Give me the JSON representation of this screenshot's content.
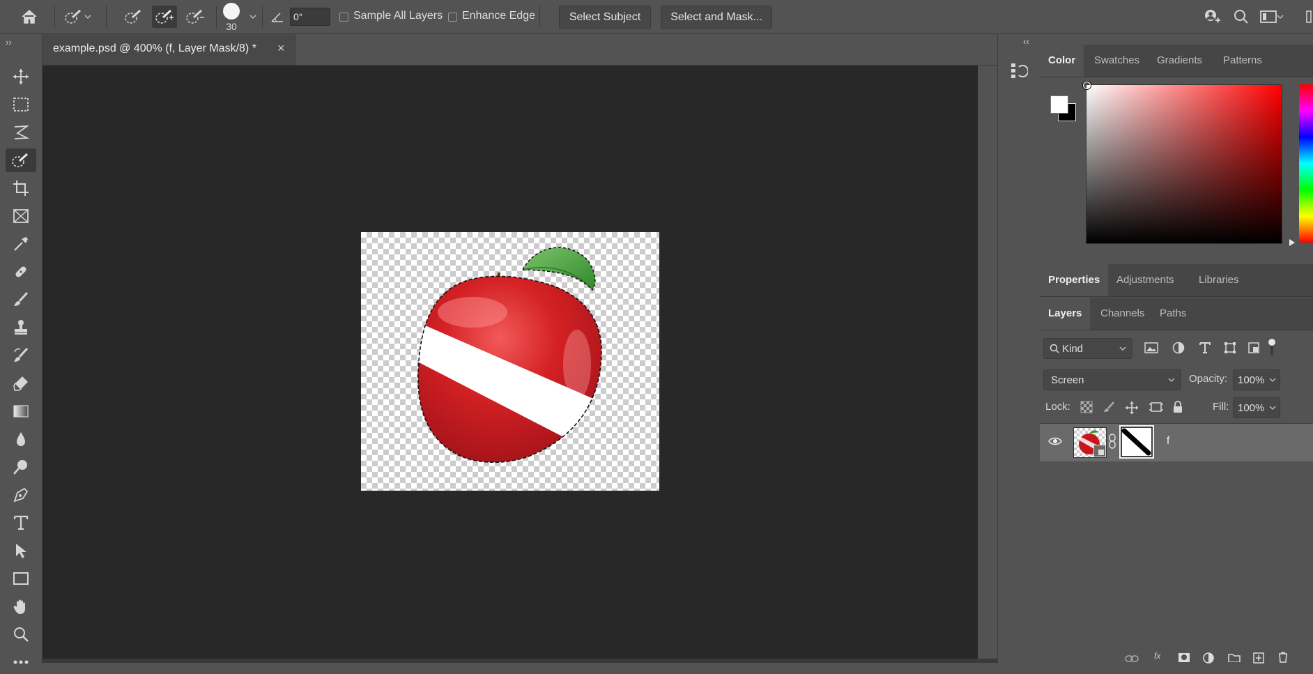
{
  "options_bar": {
    "brush_size": "30",
    "angle_value": "0°",
    "sample_all_layers": "Sample All Layers",
    "enhance_edge": "Enhance Edge",
    "select_subject": "Select Subject",
    "select_and_mask": "Select and Mask..."
  },
  "document": {
    "tab_title": "example.psd @ 400% (f, Layer Mask/8) *",
    "close_glyph": "×"
  },
  "tools": [
    {
      "name": "move-tool-icon"
    },
    {
      "name": "marquee-tool-icon"
    },
    {
      "name": "lasso-tool-icon"
    },
    {
      "name": "quick-selection-tool-icon",
      "active": true
    },
    {
      "name": "crop-tool-icon"
    },
    {
      "name": "frame-tool-icon"
    },
    {
      "name": "eyedropper-tool-icon"
    },
    {
      "name": "healing-brush-tool-icon"
    },
    {
      "name": "brush-tool-icon"
    },
    {
      "name": "clone-stamp-tool-icon"
    },
    {
      "name": "history-brush-tool-icon"
    },
    {
      "name": "eraser-tool-icon"
    },
    {
      "name": "gradient-tool-icon"
    },
    {
      "name": "blur-tool-icon"
    },
    {
      "name": "dodge-tool-icon"
    },
    {
      "name": "pen-tool-icon"
    },
    {
      "name": "type-tool-icon"
    },
    {
      "name": "path-selection-tool-icon"
    },
    {
      "name": "rectangle-tool-icon"
    },
    {
      "name": "hand-tool-icon"
    },
    {
      "name": "zoom-tool-icon"
    },
    {
      "name": "more-tools-icon"
    }
  ],
  "color_panel": {
    "tabs": [
      "Color",
      "Swatches",
      "Gradients",
      "Patterns"
    ],
    "active_tab": "Color",
    "foreground": "#ffffff",
    "background": "#000000",
    "hue_color": "#ff0000"
  },
  "properties_panel": {
    "tabs": [
      "Properties",
      "Adjustments",
      "Libraries"
    ],
    "active_tab": "Properties"
  },
  "layers_panel": {
    "tabs": [
      "Layers",
      "Channels",
      "Paths"
    ],
    "active_tab": "Layers",
    "filter_kind": "Kind",
    "blend_mode": "Screen",
    "opacity_label": "Opacity:",
    "opacity_value": "100%",
    "lock_label": "Lock:",
    "fill_label": "Fill:",
    "fill_value": "100%",
    "layers": [
      {
        "name": "f",
        "visible": true,
        "has_mask": true
      }
    ]
  }
}
